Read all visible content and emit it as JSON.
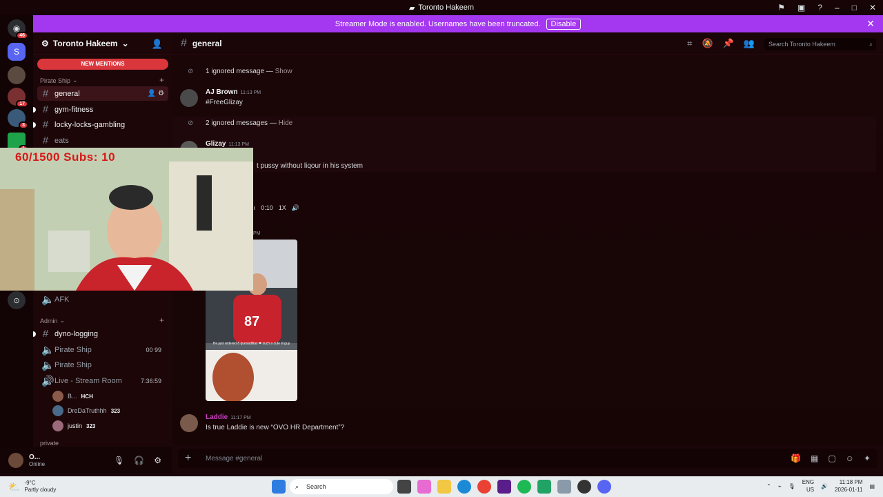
{
  "window": {
    "title": "Toronto Hakeem"
  },
  "banner": {
    "text": "Streamer Mode is enabled. Usernames have been truncated.",
    "disable_label": "Disable"
  },
  "rail": {
    "badges": [
      "46",
      "17",
      "3",
      "1"
    ]
  },
  "server": {
    "name": "Toronto Hakeem",
    "mentions_label": "NEW MENTIONS"
  },
  "sidebar": {
    "categories": {
      "pirate": "Pirate Ship",
      "admin": "Admin",
      "private": "private"
    },
    "channels": {
      "general": "general",
      "gym": "gym-fitness",
      "gambling": "locky-locks-gambling",
      "eats": "eats",
      "afk": "AFK",
      "dyno": "dyno-logging",
      "pirate1": "Pirate Ship",
      "pirate2": "Pirate Ship",
      "live": "Live - Stream Room"
    },
    "pirate1_tag": "00  99",
    "live_timer": "7:36:59",
    "voice_users": [
      {
        "name": "B...",
        "badge": "HCH"
      },
      {
        "name": "DreDaTruthhh",
        "badge": "323"
      },
      {
        "name": "justin",
        "badge": "323"
      }
    ]
  },
  "user": {
    "name": "O...",
    "status": "Online"
  },
  "chat": {
    "channel": "general",
    "search_placeholder": "Search Toronto Hakeem",
    "composer_placeholder": "Message #general",
    "ignored1": {
      "text": "1 ignored message — ",
      "action": "Show"
    },
    "ignored2": {
      "text": "2 ignored messages — ",
      "action": "Hide"
    },
    "messages": [
      {
        "author": "AJ Brown",
        "time": "11:13 PM",
        "text": "#FreeGlizay"
      },
      {
        "author": "Glizay",
        "time": "11:13 PM",
        "text": "t pussy without liqour in his system"
      },
      {
        "author": "Laddie",
        "time": "11:17 PM",
        "text": "Is true Laddie is new “OVO HR Department”?"
      }
    ],
    "voice": {
      "duration": "0:10",
      "speed": "1X"
    },
    "image_caption": "He just ordered 8 quesadillas ❤ such a cute lil guy",
    "image_time": "PM"
  },
  "webcam": {
    "goal_text": "60/1500  Subs: 10"
  },
  "taskbar": {
    "temp": "-9°C",
    "weather": "Partly cloudy",
    "search_placeholder": "Search",
    "lang": "ENG",
    "region": "US",
    "time": "11:18 PM",
    "date": "2026-01-11"
  },
  "colors": {
    "accent": "#a437f0",
    "mentions": "#da373c",
    "laddie": "#c93fc0"
  }
}
